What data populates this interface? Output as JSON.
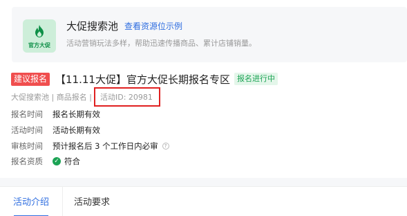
{
  "pool": {
    "logo_icon": "flame-icon",
    "logo_text": "官方大促",
    "title": "大促搜索池",
    "link": "查看资源位示例",
    "desc": "活动营销玩法多样，帮助迅速传播商品、累计店铺销量。"
  },
  "activity": {
    "suggest_tag": "建议报名",
    "title": "【11.11大促】官方大促长期报名专区",
    "status": "报名进行中",
    "meta_prefix": "大促搜索池 | 商品报名 |",
    "meta_id": "活动ID: 20981",
    "highlight_color": "#e02020"
  },
  "info": [
    {
      "label": "报名时间",
      "value": "报名长期有效"
    },
    {
      "label": "活动时间",
      "value": "活动长期有效"
    },
    {
      "label": "审核时间",
      "value": "预计报名后 3 个工作日内必审"
    },
    {
      "label": "报名资质",
      "value": "符合"
    }
  ],
  "tabs": [
    {
      "label": "活动介绍",
      "active": true
    },
    {
      "label": "活动要求",
      "active": false
    }
  ],
  "colors": {
    "accent": "#2f6ee0",
    "success": "#1ba354",
    "danger": "#f04e4e"
  }
}
